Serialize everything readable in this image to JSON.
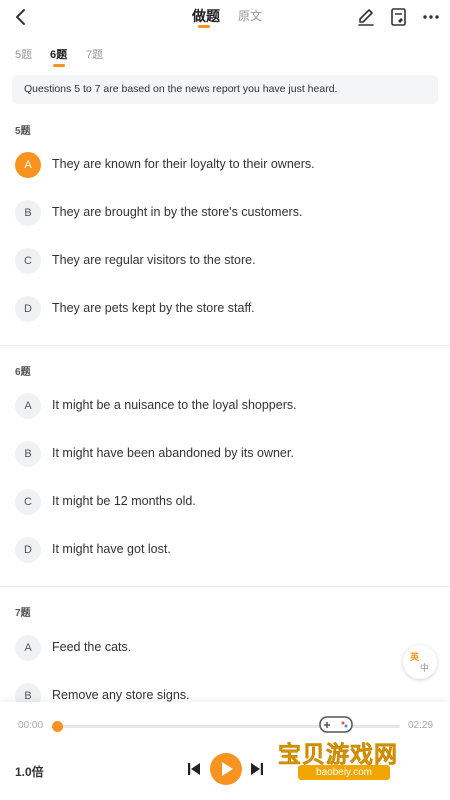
{
  "header": {
    "tab_practice": "做题",
    "tab_original": "原文"
  },
  "question_tabs": [
    "5题",
    "6题",
    "7题"
  ],
  "instruction": "Questions 5 to 7 are based on the news report you have just heard.",
  "questions": [
    {
      "label": "5题",
      "options": [
        {
          "letter": "A",
          "text": "They are known for their loyalty to their owners.",
          "selected": true
        },
        {
          "letter": "B",
          "text": "They are brought in by the store's customers."
        },
        {
          "letter": "C",
          "text": "They are regular visitors to the store."
        },
        {
          "letter": "D",
          "text": "They are pets kept by the store staff."
        }
      ]
    },
    {
      "label": "6题",
      "options": [
        {
          "letter": "A",
          "text": "It might be a nuisance to the loyal shoppers."
        },
        {
          "letter": "B",
          "text": "It might have been abandoned by its owner."
        },
        {
          "letter": "C",
          "text": "It might be 12 months old."
        },
        {
          "letter": "D",
          "text": "It might have got lost."
        }
      ]
    },
    {
      "label": "7题",
      "options": [
        {
          "letter": "A",
          "text": "Feed the cats."
        },
        {
          "letter": "B",
          "text": "Remove any store signs."
        }
      ]
    }
  ],
  "language_toggle": {
    "primary": "英",
    "secondary": "中"
  },
  "player": {
    "current_time": "00:00",
    "total_time": "02:29",
    "progress": 0,
    "speed": "1.0倍"
  },
  "watermark": {
    "title": "宝贝游戏网",
    "url": "baobeiy.com"
  },
  "colors": {
    "accent": "#f7931e",
    "option_bg": "#f0f1f3",
    "instruction_bg": "#f4f5f7"
  },
  "icons": [
    "back-icon",
    "edit-icon",
    "notes-icon",
    "more-icon",
    "previous-track-icon",
    "play-icon",
    "next-track-icon"
  ]
}
